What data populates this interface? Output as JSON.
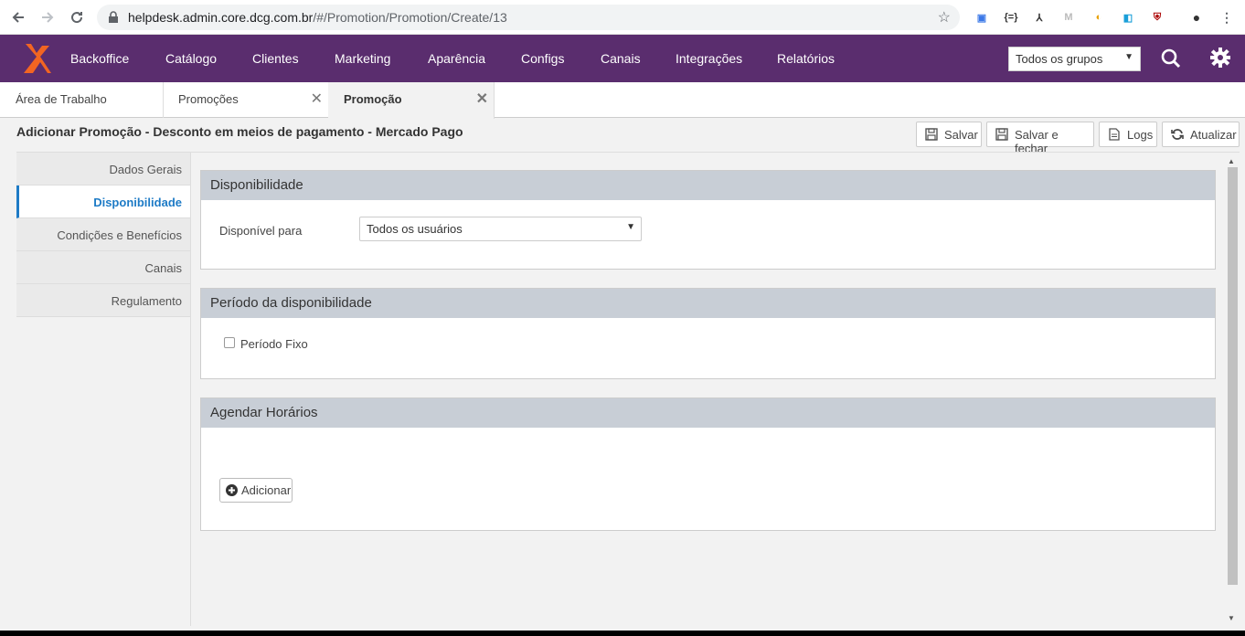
{
  "browser": {
    "url_host": "helpdesk.admin.core.dcg.com.br",
    "url_path": "/#/Promotion/Promotion/Create/13"
  },
  "topnav": {
    "menu": [
      "Backoffice",
      "Catálogo",
      "Clientes",
      "Marketing",
      "Aparência",
      "Configs",
      "Canais",
      "Integrações",
      "Relatórios"
    ],
    "group_select": "Todos os grupos",
    "brand_color": "#5a2d6e"
  },
  "tabs": [
    {
      "label": "Área de Trabalho"
    },
    {
      "label": "Promoções"
    },
    {
      "label": "Promoção"
    }
  ],
  "header": {
    "title": "Adicionar Promoção - Desconto em meios de pagamento - Mercado Pago",
    "buttons": {
      "save": "Salvar",
      "save_close": "Salvar e fechar",
      "logs": "Logs",
      "refresh": "Atualizar"
    }
  },
  "sidenav": {
    "items": [
      "Dados Gerais",
      "Disponibilidade",
      "Condições e Benefícios",
      "Canais",
      "Regulamento"
    ],
    "active": "Disponibilidade"
  },
  "availability": {
    "title": "Disponibilidade",
    "field_label": "Disponível para",
    "field_value": "Todos os usuários"
  },
  "period": {
    "title": "Período da disponibilidade",
    "checkbox_label": "Período Fixo"
  },
  "schedule": {
    "title": "Agendar Horários",
    "add_label": "Adicionar"
  }
}
